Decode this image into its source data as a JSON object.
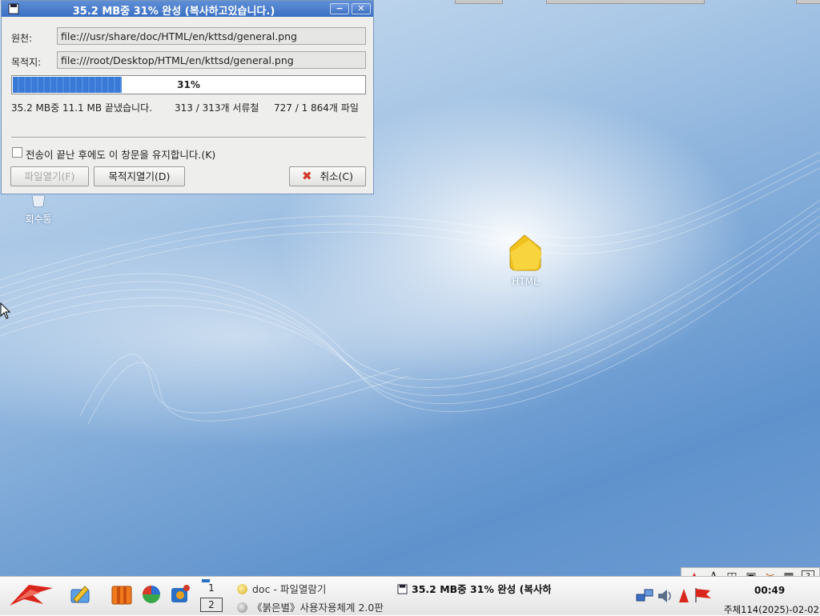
{
  "dialog": {
    "title": "35.2 MB중 31% 완성 (복사하고있습니다.)",
    "minimize_label": "−",
    "close_label": "✕",
    "source_label": "원천:",
    "source_value": "file:///usr/share/doc/HTML/en/kttsd/general.png",
    "dest_label": "목적지:",
    "dest_value": "file:///root/Desktop/HTML/en/kttsd/general.png",
    "progress_label": "31%",
    "progress_fraction": 0.31,
    "size_status": "35.2 MB중 11.1 MB 끝냈습니다.",
    "folder_status": "313 / 313개 서류철",
    "file_status": "727 / 1 864개 파일",
    "keep_open_label": "전송이 끝난 후에도 이 창문을 유지합니다.(K)",
    "keep_open_checked": false,
    "open_file_button": "파일열기(F)",
    "open_dest_button": "목적지열기(D)",
    "cancel_button": "취소(C)"
  },
  "desktop": {
    "icons": [
      {
        "label": "회수통",
        "icon": "trash-icon"
      },
      {
        "label": "HTML",
        "icon": "folder-icon"
      }
    ]
  },
  "taskbar": {
    "launchers": [
      "redstar-menu-icon",
      "editor-icon",
      "office-icon",
      "browser-icon",
      "media-icon"
    ],
    "pager": {
      "desk1": "1",
      "desk2": "2"
    },
    "tasks": [
      {
        "label": "doc - 파일열람기",
        "icon": "file-manager-icon"
      },
      {
        "label": "《붉은별》사용자용체계 2.0판",
        "icon": "system-icon"
      },
      {
        "label": "35.2 MB중 31% 완성 (복사하",
        "icon": "copy-progress-icon"
      }
    ],
    "tray": [
      "redstar-tray-icon",
      "font-icon",
      "layout-icon",
      "clipboard-icon",
      "tools-icon",
      "calculator-icon",
      "help-icon"
    ],
    "clock": "00:49",
    "date": "주체114(2025)-02-02"
  },
  "colors": {
    "title_bar": "#3a6fc4",
    "progress_fill": "#3a79d6",
    "cancel_icon": "#d23a2a"
  }
}
